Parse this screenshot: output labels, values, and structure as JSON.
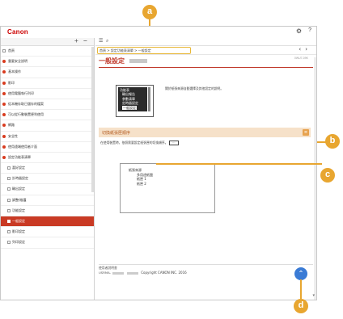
{
  "app": {
    "logo": "Canon",
    "settings_icon": "gear-icon",
    "help_label": "?"
  },
  "sidebar": {
    "add_label": "+",
    "remove_label": "−",
    "items": [
      {
        "label": "首頁",
        "type": "box"
      },
      {
        "label": "重要安全說明",
        "type": "dot"
      },
      {
        "label": "基本操作",
        "type": "dot"
      },
      {
        "label": "影印",
        "type": "dot"
      },
      {
        "label": "使用電腦執行列印",
        "type": "dot"
      },
      {
        "label": "從本機存取已儲存的檔案",
        "type": "dot"
      },
      {
        "label": "可以從行動裝置便利使用",
        "type": "dot"
      },
      {
        "label": "網路",
        "type": "dot"
      },
      {
        "label": "安全性",
        "type": "dot"
      },
      {
        "label": "使用遠端使用者介面",
        "type": "dot"
      },
      {
        "label": "設定功能表清單",
        "type": "dot"
      },
      {
        "label": "喜好設定",
        "type": "box",
        "sub": true
      },
      {
        "label": "計時器設定",
        "type": "box",
        "sub": true
      },
      {
        "label": "輸出設定",
        "type": "box",
        "sub": true
      },
      {
        "label": "調整/維護",
        "type": "box",
        "sub": true
      },
      {
        "label": "功能設定",
        "type": "box",
        "sub": true
      },
      {
        "label": "一般設定",
        "type": "box",
        "sub": true,
        "active": true
      },
      {
        "label": "影印設定",
        "type": "box",
        "sub": true
      },
      {
        "label": "列印設定",
        "type": "box",
        "sub": true
      }
    ]
  },
  "main": {
    "breadcrumb": "首頁 > 設定功能表清單 > 一般設定",
    "page_title": "一般設定",
    "doc_id": "0WU7-09K",
    "screen_items": [
      "功能表",
      "輸出報告",
      "參數清單",
      "定時器設定",
      "一般設定"
    ],
    "description": "關於紙張來源自動選擇及其他設定的說明。",
    "section_title": "切換紙張匣順序",
    "paragraph": "在使用裝置時，依照需要設定紙張匣的切換順序。",
    "example_lines": [
      "紙張來源",
      "多用途紙盤",
      "紙匣 1",
      "紙匣 2"
    ],
    "footer_line1": "使用者說明書",
    "footer_line2": "USRMA-",
    "copyright": "Copyright CANON INC. 2016"
  },
  "callouts": [
    "a",
    "b",
    "c",
    "d"
  ]
}
